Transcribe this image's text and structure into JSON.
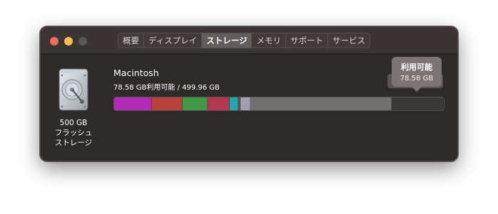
{
  "window": {
    "tabs": [
      {
        "label": "概要",
        "active": false
      },
      {
        "label": "ディスプレイ",
        "active": false
      },
      {
        "label": "ストレージ",
        "active": true
      },
      {
        "label": "メモリ",
        "active": false
      },
      {
        "label": "サポート",
        "active": false
      },
      {
        "label": "サービス",
        "active": false
      }
    ]
  },
  "disk": {
    "icon": "hard-drive-icon",
    "size": "500 GB",
    "type_line1": "フラッシュ",
    "type_line2": "ストレージ"
  },
  "volume": {
    "name": "Macintosh",
    "info": "78.58 GB利用可能 / 499.96 GB"
  },
  "storage_bar": {
    "segments": [
      {
        "category": "segment-1",
        "color": "#b12bb6",
        "fraction": 0.115
      },
      {
        "category": "segment-2",
        "color": "#b9413e",
        "fraction": 0.093
      },
      {
        "category": "segment-3",
        "color": "#3f9a45",
        "fraction": 0.075
      },
      {
        "category": "segment-4",
        "color": "#b5374f",
        "fraction": 0.068
      },
      {
        "category": "segment-5",
        "color": "#22a8ac",
        "fraction": 0.026
      },
      {
        "category": "segment-6",
        "color": "#5a5556",
        "fraction": 0.006
      },
      {
        "category": "segment-7",
        "color": "#a39fb0",
        "fraction": 0.03
      },
      {
        "category": "segment-8",
        "color": "#757070",
        "fraction": 0.43
      },
      {
        "category": "available",
        "color": "#3d3838",
        "fraction": 0.157
      }
    ]
  },
  "tooltip": {
    "title": "利用可能",
    "value": "78.58 GB"
  }
}
